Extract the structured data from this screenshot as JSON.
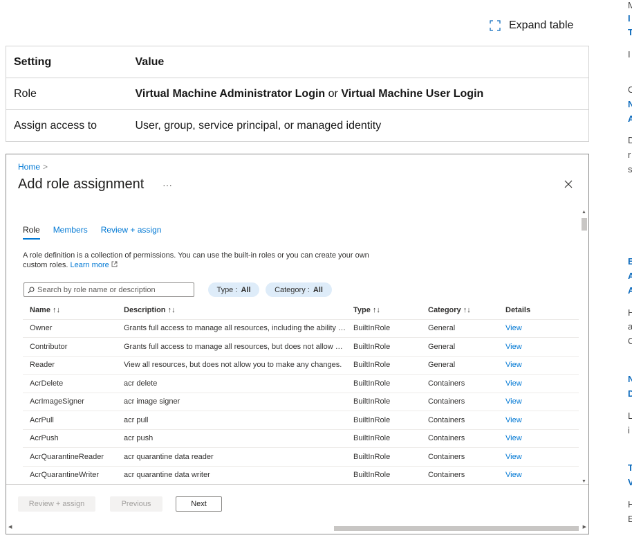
{
  "expand_table": {
    "label": "Expand table",
    "icon": "expand-icon"
  },
  "settings_table": {
    "headers": [
      "Setting",
      "Value"
    ],
    "rows": [
      {
        "setting": "Role",
        "value_bold_1": "Virtual Machine Administrator Login",
        "value_mid": " or ",
        "value_bold_2": "Virtual Machine User Login"
      },
      {
        "setting": "Assign access to",
        "value": "User, group, service principal, or managed identity"
      }
    ]
  },
  "portal": {
    "breadcrumb": "Home",
    "breadcrumb_sep": ">",
    "title": "Add role assignment",
    "ellipsis": "···",
    "tabs": [
      "Role",
      "Members",
      "Review + assign"
    ],
    "description": "A role definition is a collection of permissions. You can use the built-in roles or you can create your own custom roles.",
    "learn_more": "Learn more",
    "search_placeholder": "Search by role name or description",
    "filters": {
      "type_label": "Type : ",
      "type_value": "All",
      "category_label": "Category : ",
      "category_value": "All"
    },
    "columns": [
      "Name ↑↓",
      "Description ↑↓",
      "Type ↑↓",
      "Category ↑↓",
      "Details"
    ],
    "roles": [
      {
        "name": "Owner",
        "description": "Grants full access to manage all resources, including the ability to a...",
        "type": "BuiltInRole",
        "category": "General",
        "details": "View"
      },
      {
        "name": "Contributor",
        "description": "Grants full access to manage all resources, but does not allow you ...",
        "type": "BuiltInRole",
        "category": "General",
        "details": "View"
      },
      {
        "name": "Reader",
        "description": "View all resources, but does not allow you to make any changes.",
        "type": "BuiltInRole",
        "category": "General",
        "details": "View"
      },
      {
        "name": "AcrDelete",
        "description": "acr delete",
        "type": "BuiltInRole",
        "category": "Containers",
        "details": "View"
      },
      {
        "name": "AcrImageSigner",
        "description": "acr image signer",
        "type": "BuiltInRole",
        "category": "Containers",
        "details": "View"
      },
      {
        "name": "AcrPull",
        "description": "acr pull",
        "type": "BuiltInRole",
        "category": "Containers",
        "details": "View"
      },
      {
        "name": "AcrPush",
        "description": "acr push",
        "type": "BuiltInRole",
        "category": "Containers",
        "details": "View"
      },
      {
        "name": "AcrQuarantineReader",
        "description": "acr quarantine data reader",
        "type": "BuiltInRole",
        "category": "Containers",
        "details": "View"
      },
      {
        "name": "AcrQuarantineWriter",
        "description": "acr quarantine data writer",
        "type": "BuiltInRole",
        "category": "Containers",
        "details": "View"
      }
    ],
    "buttons": {
      "review_assign": "Review + assign",
      "previous": "Previous",
      "next": "Next"
    }
  },
  "right_rail": {
    "fragments": [
      "M",
      "I",
      "T",
      "I",
      "C",
      "N",
      "A",
      "D",
      "r",
      "s",
      "E",
      "A",
      "A",
      "H",
      "a",
      "C",
      "N",
      "D",
      "L",
      "i",
      "T",
      "V",
      "H",
      "E"
    ]
  }
}
